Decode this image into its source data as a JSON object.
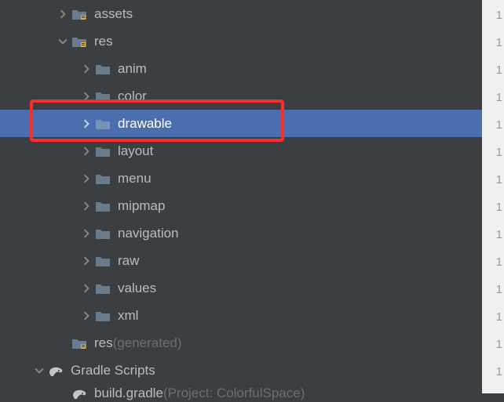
{
  "tree": {
    "assets": "assets",
    "res": "res",
    "anim": "anim",
    "color": "color",
    "drawable": "drawable",
    "layout": "layout",
    "menu": "menu",
    "mipmap": "mipmap",
    "navigation": "navigation",
    "raw": "raw",
    "values": "values",
    "xml": "xml",
    "res_generated_label": "res",
    "res_generated_suffix": " (generated)",
    "gradle_scripts": "Gradle Scripts",
    "build_gradle_label": "build.gradle",
    "build_gradle_suffix": " (Project: ColorfulSpace)"
  },
  "gutter": [
    "1",
    "1",
    "1",
    "1",
    "1",
    "1",
    "1",
    "1",
    "1",
    "1",
    "1",
    "1",
    "1",
    "1"
  ]
}
